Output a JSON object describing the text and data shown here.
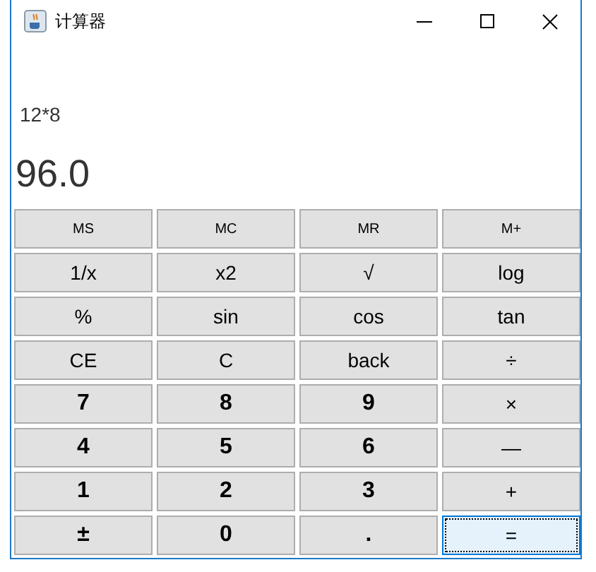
{
  "window": {
    "title": "计算器"
  },
  "expression": "12*8",
  "result": "96.0",
  "buttons": [
    [
      {
        "label": "MS",
        "kind": "memory",
        "focused": false
      },
      {
        "label": "MC",
        "kind": "memory",
        "focused": false
      },
      {
        "label": "MR",
        "kind": "memory",
        "focused": false
      },
      {
        "label": "M+",
        "kind": "memory",
        "focused": false
      }
    ],
    [
      {
        "label": "1/x",
        "kind": "function",
        "focused": false
      },
      {
        "label": "x2",
        "kind": "function",
        "focused": false
      },
      {
        "label": "√",
        "kind": "function",
        "focused": false
      },
      {
        "label": "log",
        "kind": "function",
        "focused": false
      }
    ],
    [
      {
        "label": "%",
        "kind": "function",
        "focused": false
      },
      {
        "label": "sin",
        "kind": "function",
        "focused": false
      },
      {
        "label": "cos",
        "kind": "function",
        "focused": false
      },
      {
        "label": "tan",
        "kind": "function",
        "focused": false
      }
    ],
    [
      {
        "label": "CE",
        "kind": "function",
        "focused": false
      },
      {
        "label": "C",
        "kind": "function",
        "focused": false
      },
      {
        "label": "back",
        "kind": "function",
        "focused": false
      },
      {
        "label": "÷",
        "kind": "operator",
        "focused": false
      }
    ],
    [
      {
        "label": "7",
        "kind": "digit",
        "focused": false
      },
      {
        "label": "8",
        "kind": "digit",
        "focused": false
      },
      {
        "label": "9",
        "kind": "digit",
        "focused": false
      },
      {
        "label": "×",
        "kind": "operator",
        "focused": false
      }
    ],
    [
      {
        "label": "4",
        "kind": "digit",
        "focused": false
      },
      {
        "label": "5",
        "kind": "digit",
        "focused": false
      },
      {
        "label": "6",
        "kind": "digit",
        "focused": false
      },
      {
        "label": "—",
        "kind": "operator",
        "focused": false
      }
    ],
    [
      {
        "label": "1",
        "kind": "digit",
        "focused": false
      },
      {
        "label": "2",
        "kind": "digit",
        "focused": false
      },
      {
        "label": "3",
        "kind": "digit",
        "focused": false
      },
      {
        "label": "+",
        "kind": "operator",
        "focused": false
      }
    ],
    [
      {
        "label": "±",
        "kind": "digit",
        "focused": false
      },
      {
        "label": "0",
        "kind": "digit",
        "focused": false
      },
      {
        "label": ".",
        "kind": "digit",
        "focused": false
      },
      {
        "label": "=",
        "kind": "operator",
        "focused": true
      }
    ]
  ]
}
